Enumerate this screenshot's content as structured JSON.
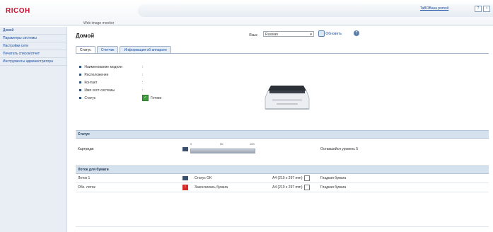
{
  "header": {
    "logo": "RICOH",
    "tagline": "Web image monitor",
    "help_link": "TaBOBasa pomoit",
    "help_btn": "?",
    "info_btn": "i"
  },
  "sidebar": {
    "items": [
      {
        "label": "Домой"
      },
      {
        "label": "Параметры системы"
      },
      {
        "label": "Настройки сети"
      },
      {
        "label": "Печатать список/отчет"
      },
      {
        "label": "Инструменты администратора"
      }
    ]
  },
  "main": {
    "title": "Домой",
    "language_label": "Язык",
    "language_value": "Russian",
    "refresh_label": "Обновить",
    "tabs": [
      {
        "label": "Статус"
      },
      {
        "label": "Счетчик"
      },
      {
        "label": "Информация об аппарате"
      }
    ],
    "info": [
      {
        "label": "Наименование модели",
        "value": ":"
      },
      {
        "label": "Расположение",
        "value": ":"
      },
      {
        "label": "Контакт",
        "value": ":"
      },
      {
        "label": "Имя хост-системы",
        "value": ":"
      },
      {
        "label": "Статус",
        "value": "Готово"
      }
    ]
  },
  "status_section": {
    "title": "Статус",
    "cartridge_label": "Картридж",
    "gauge_scale": [
      "0",
      "50",
      "100"
    ],
    "gauge_fill_percent": 100,
    "remaining_text": "Оставшийся уровень 5"
  },
  "paper_section": {
    "title": "Лоток для бумаги",
    "rows": [
      {
        "name": "Лоток 1",
        "status": "Статус OK",
        "size": "A4 (210 x 297 mm)",
        "type": "Гладкая бумага",
        "icon": "ok"
      },
      {
        "name": "Обх. лоток",
        "status": "Закончилась бумага",
        "size": "A4 (210 x 297 mm)",
        "type": "Гладкая бумага",
        "icon": "empty"
      }
    ]
  },
  "colors": {
    "brand": "#c8102e",
    "link": "#1a4fa3",
    "section_bar": "#d6e1ee",
    "ok_green": "#3e9c3e",
    "error_red": "#d22a2a"
  }
}
